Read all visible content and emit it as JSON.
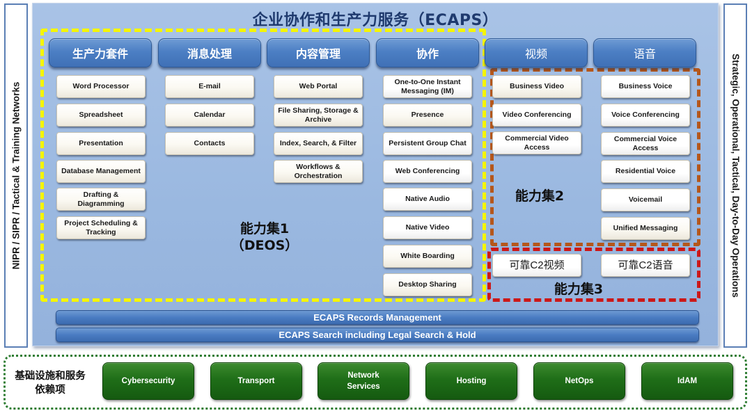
{
  "colors": {
    "panel_bg": "#9ab8e0",
    "title": "#1f3a6e",
    "header_blue": "#4c7fc4",
    "capability_set_1_border": "#f5f500",
    "capability_set_2_border": "#b5571b",
    "capability_set_3_border": "#cc1818",
    "infra_green": "#1f6e18"
  },
  "side_left": "NIPR / SIPR / Tactical & Training Networks",
  "side_right": "Strategic, Operational, Tactical, Day-to-Day Operations",
  "title": "企业协作和生产力服务（ECAPS）",
  "categories": [
    {
      "label": "生产力套件",
      "items": [
        "Word Processor",
        "Spreadsheet",
        "Presentation",
        "Database Management",
        "Drafting & Diagramming",
        "Project Scheduling & Tracking"
      ]
    },
    {
      "label": "消息处理",
      "items": [
        "E-mail",
        "Calendar",
        "Contacts"
      ]
    },
    {
      "label": "内容管理",
      "items": [
        "Web Portal",
        "File Sharing, Storage & Archive",
        "Index, Search, & Filter",
        "Workflows & Orchestration"
      ]
    },
    {
      "label": "协作",
      "items": [
        "One-to-One Instant Messaging (IM)",
        "Presence",
        "Persistent Group Chat",
        "Web Conferencing",
        "Native Audio",
        "Native Video",
        "White Boarding",
        "Desktop Sharing"
      ]
    },
    {
      "label": "视频",
      "items": [
        "Business Video",
        "Video Conferencing",
        "Commercial Video Access",
        "可靠C2视频"
      ]
    },
    {
      "label": "语音",
      "items": [
        "Business Voice",
        "Voice Conferencing",
        "Commercial Voice Access",
        "Residential Voice",
        "Voicemail",
        "Unified Messaging",
        "可靠C2语音"
      ]
    }
  ],
  "capability_sets": {
    "set1_line1": "能力集1",
    "set1_line2": "（DEOS）",
    "set2": "能力集2",
    "set3": "能力集3"
  },
  "bars": [
    "ECAPS Records Management",
    "ECAPS Search including Legal Search & Hold"
  ],
  "infrastructure": {
    "label_line1": "基础设施和服务",
    "label_line2": "依赖项",
    "items": [
      "Cybersecurity",
      "Transport",
      "Network Services",
      "Hosting",
      "NetOps",
      "IdAM"
    ]
  }
}
